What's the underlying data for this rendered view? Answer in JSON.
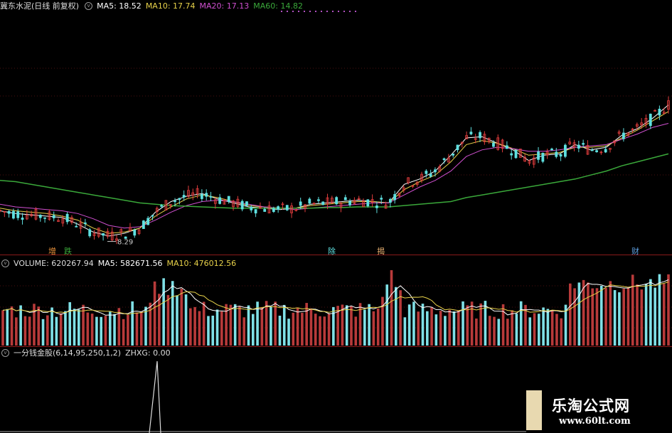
{
  "price_header": {
    "title": "冀东水泥(日线 前复权)",
    "ma5": "MA5: 18.52",
    "ma10": "MA10: 17.74",
    "ma20": "MA20: 17.13",
    "ma60": "MA60: 14.82"
  },
  "volume_header": {
    "label": "VOLUME: 620267.94",
    "ma5": "MA5: 582671.56",
    "ma10": "MA10: 476012.56"
  },
  "indicator_header": {
    "label": "一分钱金股(6,14,95,250,1,2)",
    "zhxg": "ZHXG: 0.00"
  },
  "low_price_label": "8.29",
  "markers": [
    "增",
    "跌",
    "除",
    "揭",
    "财"
  ],
  "watermark": {
    "name": "乐淘公式网",
    "url": "www.60lt.com"
  },
  "colors": {
    "up": "#e03c3c",
    "down": "#5fe0e0",
    "ma5": "#ffffff",
    "ma10": "#e8d24a",
    "ma20": "#d050d0",
    "ma60": "#3aa83a",
    "separator": "#8a1a1a"
  },
  "chart_data": [
    {
      "type": "line",
      "name": "price",
      "series": [
        {
          "name": "MA5",
          "values": [
            10.6,
            10.4,
            10.3,
            10.2,
            10.1,
            9.6,
            9.0,
            8.7,
            8.9,
            9.3,
            10.5,
            11.3,
            11.7,
            11.9,
            11.5,
            11.2,
            10.9,
            10.8,
            10.7,
            10.8,
            11.1,
            11.2,
            11.3,
            11.4,
            11.3,
            11.2,
            12.6,
            13.0,
            13.6,
            14.8,
            16.1,
            16.2,
            15.7,
            15.2,
            14.4,
            14.8,
            14.9,
            15.6,
            15.2,
            15.4,
            16.3,
            16.8,
            17.6,
            18.6
          ]
        },
        {
          "name": "MA10",
          "values": [
            10.8,
            10.6,
            10.5,
            10.4,
            10.2,
            9.9,
            9.3,
            8.9,
            9.0,
            9.3,
            10.2,
            10.9,
            11.5,
            11.8,
            11.6,
            11.3,
            11.0,
            10.9,
            10.8,
            10.8,
            11.0,
            11.1,
            11.2,
            11.3,
            11.3,
            11.2,
            12.2,
            12.8,
            13.3,
            14.3,
            15.6,
            15.9,
            15.7,
            15.3,
            14.8,
            14.9,
            15.0,
            15.4,
            15.4,
            15.5,
            16.1,
            16.7,
            17.4,
            18.1
          ]
        },
        {
          "name": "MA20",
          "values": [
            11.1,
            10.9,
            10.8,
            10.7,
            10.6,
            10.4,
            10.0,
            9.5,
            9.3,
            9.4,
            9.9,
            10.5,
            11.0,
            11.3,
            11.4,
            11.3,
            11.1,
            10.9,
            10.8,
            10.7,
            10.8,
            10.9,
            11.0,
            11.1,
            11.2,
            11.2,
            11.8,
            12.4,
            12.9,
            13.6,
            14.7,
            15.2,
            15.4,
            15.3,
            15.1,
            15.1,
            15.2,
            15.4,
            15.5,
            15.6,
            16.0,
            16.4,
            16.9,
            17.2
          ]
        },
        {
          "name": "MA60",
          "values": [
            12.9,
            12.8,
            12.6,
            12.4,
            12.2,
            12.0,
            11.8,
            11.6,
            11.4,
            11.2,
            11.1,
            11.0,
            10.95,
            10.9,
            10.85,
            10.8,
            10.8,
            10.8,
            10.8,
            10.8,
            10.8,
            10.85,
            10.85,
            10.9,
            10.9,
            10.9,
            11.0,
            11.1,
            11.2,
            11.3,
            11.6,
            11.8,
            12.0,
            12.2,
            12.4,
            12.6,
            12.8,
            13.0,
            13.3,
            13.6,
            14.0,
            14.3,
            14.6,
            14.9
          ]
        }
      ],
      "annotations": [
        "8.29"
      ]
    },
    {
      "type": "bar",
      "name": "VOLUME",
      "values": [
        620267.94
      ],
      "series": [
        {
          "name": "MA5",
          "values": [
            582671.56
          ]
        },
        {
          "name": "MA10",
          "values": [
            476012.56
          ]
        }
      ]
    },
    {
      "type": "line",
      "name": "一分钱金股(6,14,95,250,1,2)",
      "series": [
        {
          "name": "ZHXG",
          "values": [
            0.0
          ]
        }
      ]
    }
  ]
}
